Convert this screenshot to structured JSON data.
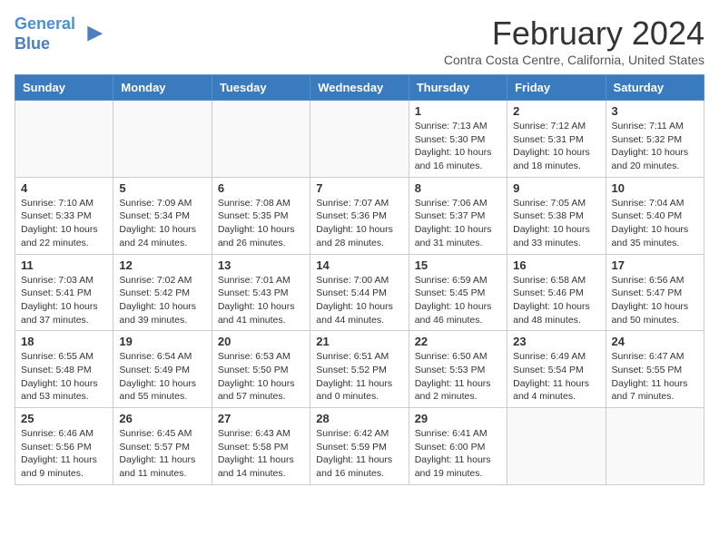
{
  "logo": {
    "line1": "General",
    "line2": "Blue"
  },
  "title": "February 2024",
  "subtitle": "Contra Costa Centre, California, United States",
  "days_header": [
    "Sunday",
    "Monday",
    "Tuesday",
    "Wednesday",
    "Thursday",
    "Friday",
    "Saturday"
  ],
  "weeks": [
    [
      {
        "day": "",
        "info": ""
      },
      {
        "day": "",
        "info": ""
      },
      {
        "day": "",
        "info": ""
      },
      {
        "day": "",
        "info": ""
      },
      {
        "day": "1",
        "info": "Sunrise: 7:13 AM\nSunset: 5:30 PM\nDaylight: 10 hours\nand 16 minutes."
      },
      {
        "day": "2",
        "info": "Sunrise: 7:12 AM\nSunset: 5:31 PM\nDaylight: 10 hours\nand 18 minutes."
      },
      {
        "day": "3",
        "info": "Sunrise: 7:11 AM\nSunset: 5:32 PM\nDaylight: 10 hours\nand 20 minutes."
      }
    ],
    [
      {
        "day": "4",
        "info": "Sunrise: 7:10 AM\nSunset: 5:33 PM\nDaylight: 10 hours\nand 22 minutes."
      },
      {
        "day": "5",
        "info": "Sunrise: 7:09 AM\nSunset: 5:34 PM\nDaylight: 10 hours\nand 24 minutes."
      },
      {
        "day": "6",
        "info": "Sunrise: 7:08 AM\nSunset: 5:35 PM\nDaylight: 10 hours\nand 26 minutes."
      },
      {
        "day": "7",
        "info": "Sunrise: 7:07 AM\nSunset: 5:36 PM\nDaylight: 10 hours\nand 28 minutes."
      },
      {
        "day": "8",
        "info": "Sunrise: 7:06 AM\nSunset: 5:37 PM\nDaylight: 10 hours\nand 31 minutes."
      },
      {
        "day": "9",
        "info": "Sunrise: 7:05 AM\nSunset: 5:38 PM\nDaylight: 10 hours\nand 33 minutes."
      },
      {
        "day": "10",
        "info": "Sunrise: 7:04 AM\nSunset: 5:40 PM\nDaylight: 10 hours\nand 35 minutes."
      }
    ],
    [
      {
        "day": "11",
        "info": "Sunrise: 7:03 AM\nSunset: 5:41 PM\nDaylight: 10 hours\nand 37 minutes."
      },
      {
        "day": "12",
        "info": "Sunrise: 7:02 AM\nSunset: 5:42 PM\nDaylight: 10 hours\nand 39 minutes."
      },
      {
        "day": "13",
        "info": "Sunrise: 7:01 AM\nSunset: 5:43 PM\nDaylight: 10 hours\nand 41 minutes."
      },
      {
        "day": "14",
        "info": "Sunrise: 7:00 AM\nSunset: 5:44 PM\nDaylight: 10 hours\nand 44 minutes."
      },
      {
        "day": "15",
        "info": "Sunrise: 6:59 AM\nSunset: 5:45 PM\nDaylight: 10 hours\nand 46 minutes."
      },
      {
        "day": "16",
        "info": "Sunrise: 6:58 AM\nSunset: 5:46 PM\nDaylight: 10 hours\nand 48 minutes."
      },
      {
        "day": "17",
        "info": "Sunrise: 6:56 AM\nSunset: 5:47 PM\nDaylight: 10 hours\nand 50 minutes."
      }
    ],
    [
      {
        "day": "18",
        "info": "Sunrise: 6:55 AM\nSunset: 5:48 PM\nDaylight: 10 hours\nand 53 minutes."
      },
      {
        "day": "19",
        "info": "Sunrise: 6:54 AM\nSunset: 5:49 PM\nDaylight: 10 hours\nand 55 minutes."
      },
      {
        "day": "20",
        "info": "Sunrise: 6:53 AM\nSunset: 5:50 PM\nDaylight: 10 hours\nand 57 minutes."
      },
      {
        "day": "21",
        "info": "Sunrise: 6:51 AM\nSunset: 5:52 PM\nDaylight: 11 hours\nand 0 minutes."
      },
      {
        "day": "22",
        "info": "Sunrise: 6:50 AM\nSunset: 5:53 PM\nDaylight: 11 hours\nand 2 minutes."
      },
      {
        "day": "23",
        "info": "Sunrise: 6:49 AM\nSunset: 5:54 PM\nDaylight: 11 hours\nand 4 minutes."
      },
      {
        "day": "24",
        "info": "Sunrise: 6:47 AM\nSunset: 5:55 PM\nDaylight: 11 hours\nand 7 minutes."
      }
    ],
    [
      {
        "day": "25",
        "info": "Sunrise: 6:46 AM\nSunset: 5:56 PM\nDaylight: 11 hours\nand 9 minutes."
      },
      {
        "day": "26",
        "info": "Sunrise: 6:45 AM\nSunset: 5:57 PM\nDaylight: 11 hours\nand 11 minutes."
      },
      {
        "day": "27",
        "info": "Sunrise: 6:43 AM\nSunset: 5:58 PM\nDaylight: 11 hours\nand 14 minutes."
      },
      {
        "day": "28",
        "info": "Sunrise: 6:42 AM\nSunset: 5:59 PM\nDaylight: 11 hours\nand 16 minutes."
      },
      {
        "day": "29",
        "info": "Sunrise: 6:41 AM\nSunset: 6:00 PM\nDaylight: 11 hours\nand 19 minutes."
      },
      {
        "day": "",
        "info": ""
      },
      {
        "day": "",
        "info": ""
      }
    ]
  ]
}
